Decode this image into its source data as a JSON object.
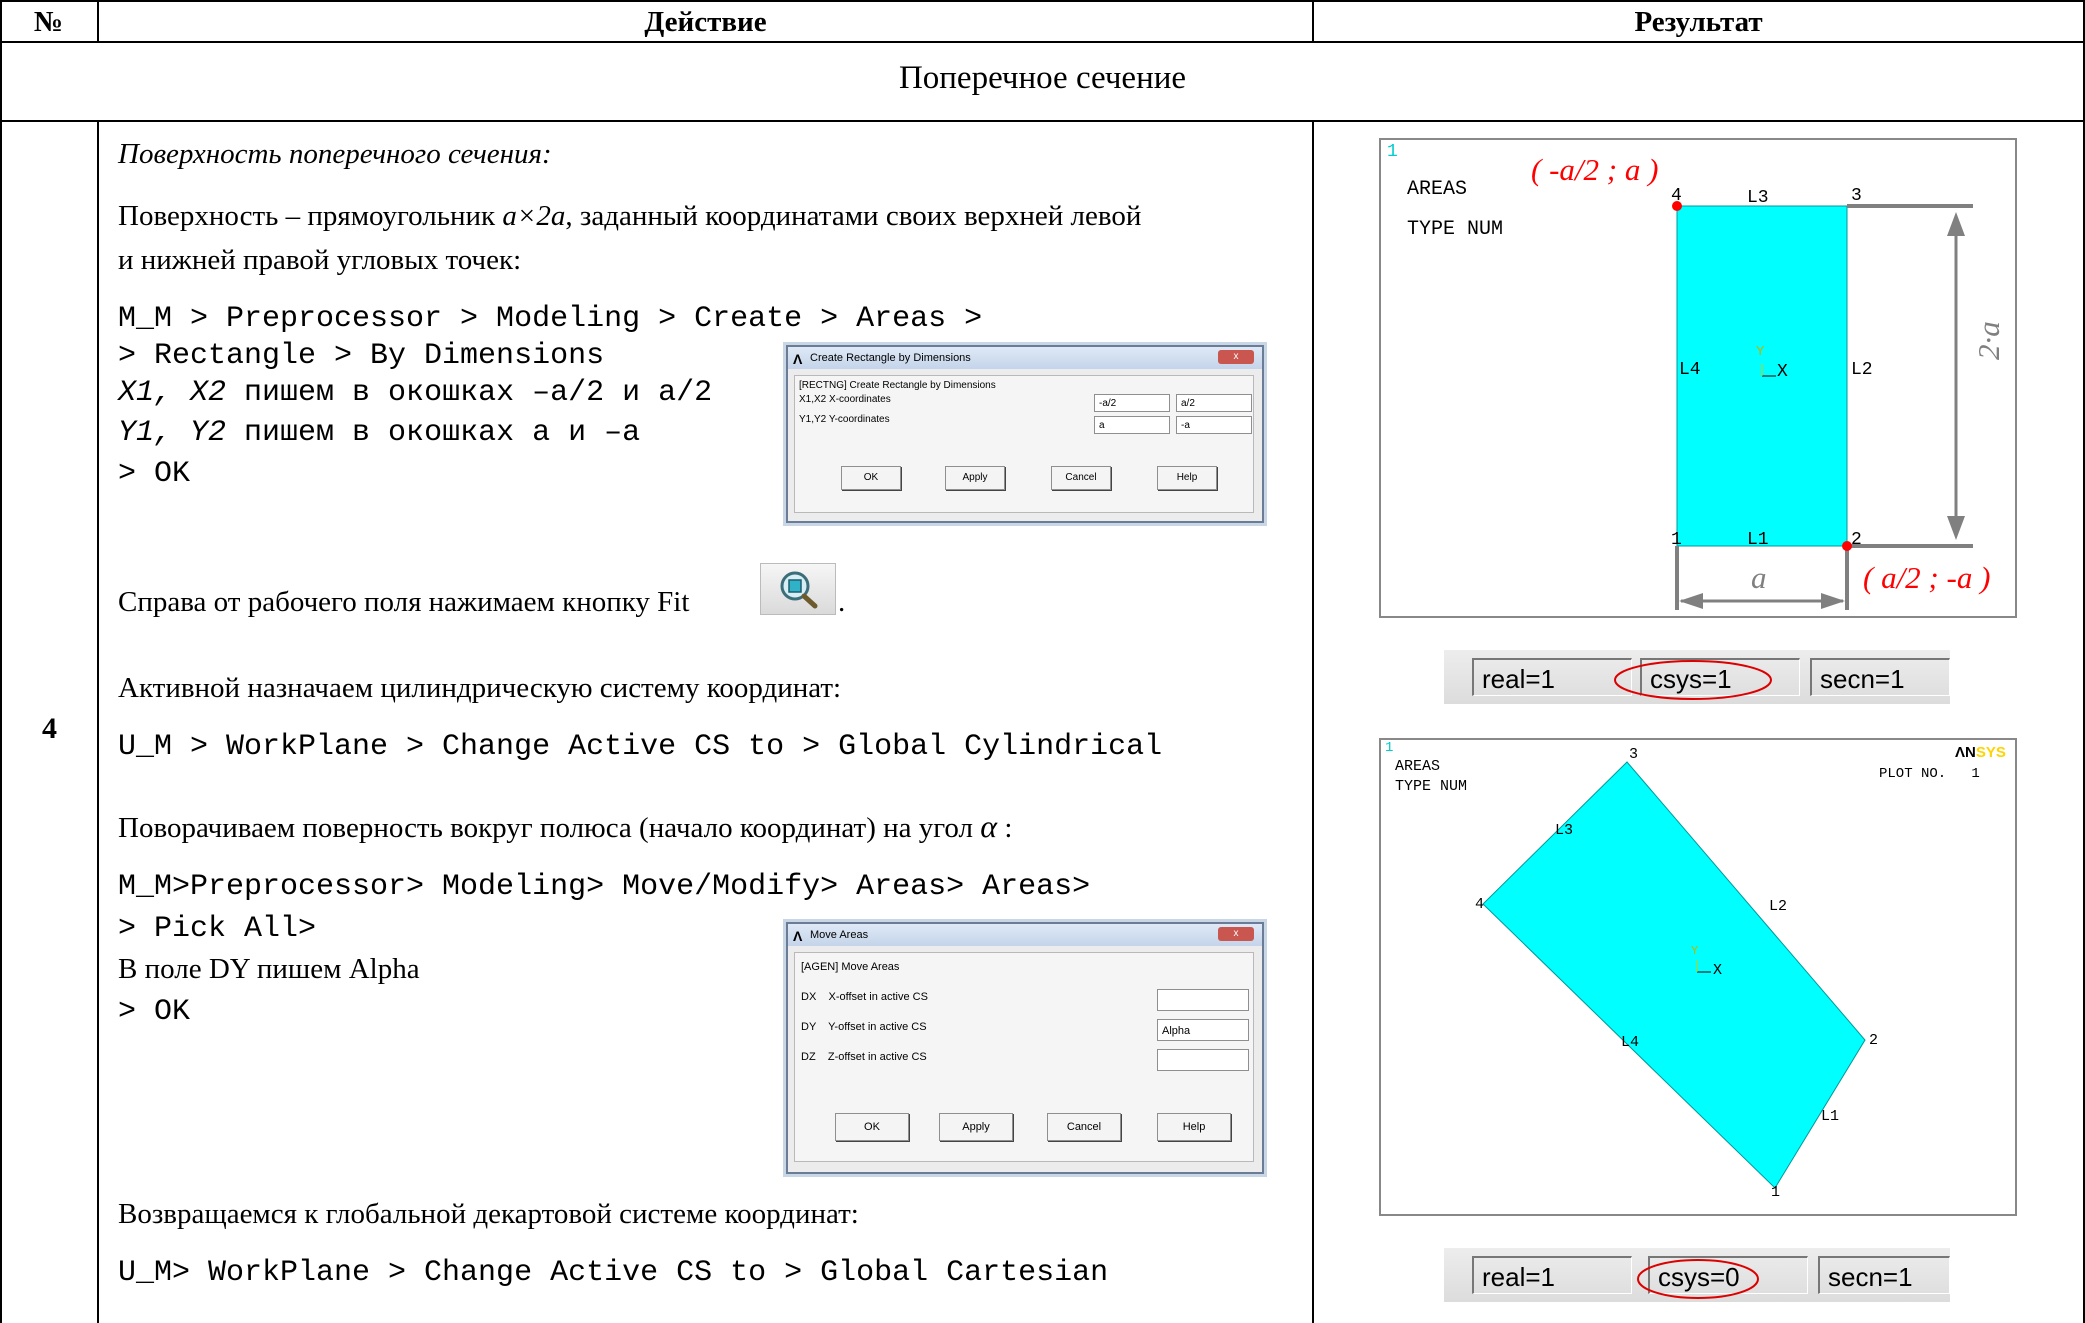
{
  "table": {
    "headers": {
      "num": "№",
      "action": "Действие",
      "result": "Результат"
    },
    "section_title": "Поперечное сечение",
    "row_number": "4"
  },
  "action": {
    "p1": "Поверхность поперечного сечения:",
    "p2_a": "Поверхность – прямоугольник ",
    "p2_dim": "a×2a",
    "p2_b": ", заданный координатами своих верхней левой",
    "p2_c": "и нижней правой угловых точек:",
    "code1_l1": "M_M > Preprocessor > Modeling > Create > Areas >",
    "code1_l2": "> Rectangle > By Dimensions",
    "code1_l3_it": "X1, X2",
    "code1_l3_rest": " пишем в окошках –a/2 и a/2",
    "code1_l4_it": "Y1, Y2",
    "code1_l4_rest": " пишем в окошках a и –a",
    "code1_l5": "> OK",
    "fit_text": "Справа от рабочего поля нажимаем кнопку Fit",
    "fit_dot": ".",
    "p_cyl": "Активной назначаем цилиндрическую систему координат:",
    "code_cyl": "U_M > WorkPlane > Change Active CS to > Global Cylindrical",
    "p_rot": "Поворачиваем поверность вокруг полюса (начало координат) на угол ",
    "alpha": "α",
    "p_rot_end": " :",
    "code2_l1": "M_M>Preprocessor> Modeling> Move/Modify> Areas> Areas>",
    "code2_l2": "> Pick All>",
    "code2_l3": "В поле DY пишем  Alpha",
    "code2_l4": "> OK",
    "p_back": "Возвращаемся к глобальной декартовой системе координат:",
    "code_cart": "U_M> WorkPlane > Change Active CS to > Global Cartesian"
  },
  "dialog_rect": {
    "title": "Create Rectangle by Dimensions",
    "logo": "Λ",
    "close": "x",
    "header": "[RECTNG]  Create Rectangle by Dimensions",
    "row1_label": "X1,X2  X-coordinates",
    "row1_v1": "-a/2",
    "row1_v2": "a/2",
    "row2_label": "Y1,Y2  Y-coordinates",
    "row2_v1": "a",
    "row2_v2": "-a",
    "ok": "OK",
    "apply": "Apply",
    "cancel": "Cancel",
    "help": "Help"
  },
  "dialog_move": {
    "title": "Move Areas",
    "logo": "Λ",
    "close": "x",
    "header": "[AGEN]  Move Areas",
    "dx_label": "DX    X-offset in active CS",
    "dy_label": "DY    Y-offset in active CS",
    "dz_label": "DZ    Z-offset in active CS",
    "dx_val": "",
    "dy_val": "Alpha",
    "dz_val": "",
    "ok": "OK",
    "apply": "Apply",
    "cancel": "Cancel",
    "help": "Help"
  },
  "plot1": {
    "num": "1",
    "areas": "AREAS",
    "type": "TYPE NUM",
    "ann_top": "( -a/2 ; a )",
    "ann_bottom": "( a/2 ; -a )",
    "dim_a": "a",
    "dim_2a": "2·a",
    "k1": "1",
    "k2": "2",
    "k3": "3",
    "k4": "4",
    "l1": "L1",
    "l2": "L2",
    "l3": "L3",
    "l4": "L4",
    "axis_y": "Y",
    "axis_x": "X",
    "fill_color": "#00ffff",
    "marker_color": "#ff0000"
  },
  "status1": {
    "real": "real=1",
    "csys": "csys=1",
    "secn": "secn=1"
  },
  "plot2": {
    "num": "1",
    "areas": "AREAS",
    "type": "TYPE NUM",
    "plotno": "PLOT NO.   1",
    "logo_a": "ΛN",
    "logo_b": "SYS",
    "k1": "1",
    "k2": "2",
    "k3": "3",
    "k4": "4",
    "l1": "L1",
    "l2": "L2",
    "l3": "L3",
    "l4": "L4",
    "axis_y": "Y",
    "axis_x": "X"
  },
  "status2": {
    "real": "real=1",
    "csys": "csys=0",
    "secn": "secn=1"
  }
}
